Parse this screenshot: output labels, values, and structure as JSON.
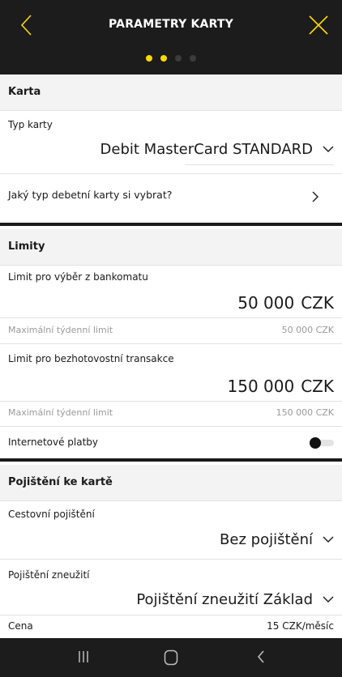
{
  "header": {
    "title": "PARAMETRY KARTY",
    "steps_total": 4,
    "steps_active": 2,
    "accent": "#ffd800"
  },
  "karta": {
    "section_title": "Karta",
    "type_label": "Typ karty",
    "type_value": "Debit MasterCard STANDARD",
    "help_link": "Jaký typ debetní karty si vybrat?"
  },
  "limity": {
    "section_title": "Limity",
    "atm_label": "Limit pro výběr z bankomatu",
    "atm_value": "50 000",
    "atm_currency": "CZK",
    "atm_week_label": "Maximální týdenní limit",
    "atm_week_value": "50 000 CZK",
    "cashless_label": "Limit pro bezhotovostní transakce",
    "cashless_value": "150 000",
    "cashless_currency": "CZK",
    "cashless_week_label": "Maximální týdenní limit",
    "cashless_week_value": "150 000 CZK",
    "internet_label": "Internetové platby",
    "internet_enabled": true
  },
  "pojisteni": {
    "section_title": "Pojištění ke kartě",
    "travel_label": "Cestovní pojištění",
    "travel_value": "Bez pojištění",
    "misuse_label": "Pojištění zneužití",
    "misuse_value": "Pojištění zneužití Základ",
    "price_label": "Cena",
    "price_value": "15 CZK/měsíc"
  },
  "icons": {
    "back": "chevron-left-icon",
    "close": "close-icon",
    "nav_recent": "recent-apps-icon",
    "nav_home": "home-icon",
    "nav_back": "back-icon"
  }
}
